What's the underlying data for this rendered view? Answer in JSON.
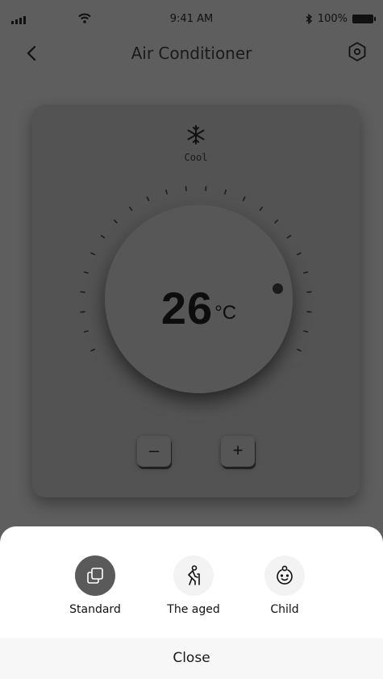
{
  "status_bar": {
    "time": "9:41 AM",
    "battery": "100%"
  },
  "nav": {
    "title": "Air Conditioner",
    "back_icon": "chevron-left-icon",
    "settings_icon": "settings-hexagon-icon"
  },
  "thermostat": {
    "mode_icon": "snowflake-icon",
    "mode_label": "Cool",
    "temperature": "26",
    "unit": "°C",
    "minus_label": "–",
    "plus_label": "+"
  },
  "mode_sheet": {
    "options": [
      {
        "label": "Standard",
        "icon": "standard-mode-icon",
        "selected": true
      },
      {
        "label": "The aged",
        "icon": "elderly-person-icon",
        "selected": false
      },
      {
        "label": "Child",
        "icon": "baby-face-icon",
        "selected": false
      }
    ],
    "close_label": "Close"
  },
  "colors": {
    "overlay_bg": "#5e5e5e",
    "card_bg": "#535353",
    "sheet_bg": "#ffffff",
    "selected_option_bg": "#5a5a5a"
  }
}
